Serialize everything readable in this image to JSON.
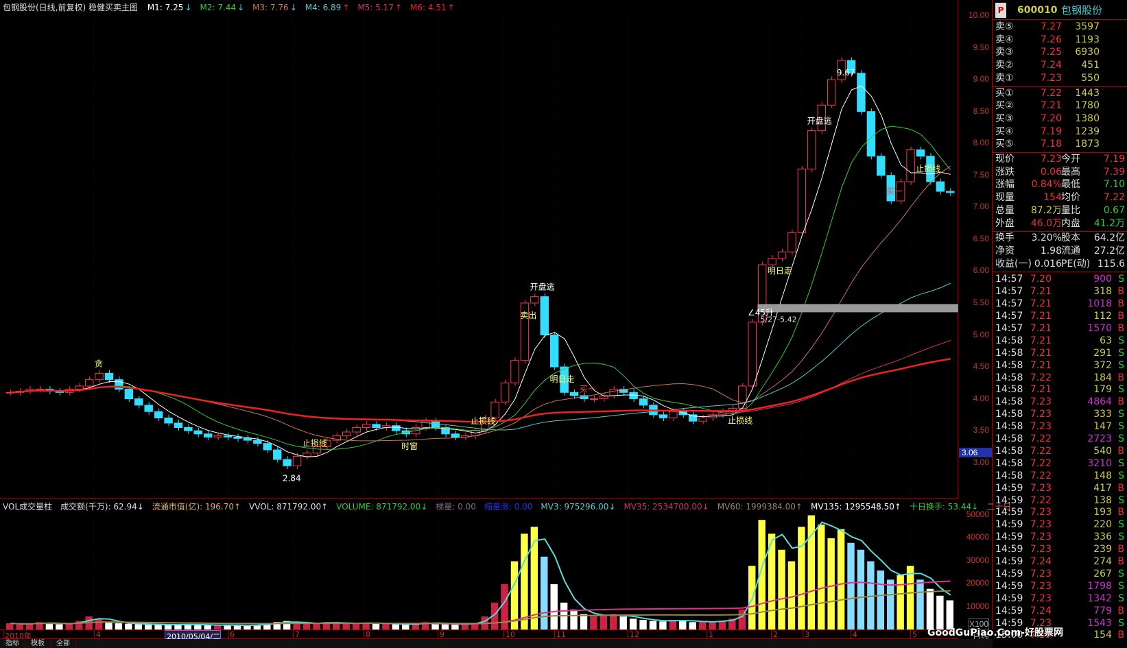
{
  "header": {
    "title": "包钢股份(日线,前复权) 稳健买卖主图",
    "mas": [
      {
        "label": "M1: 7.25",
        "arrow": "↓",
        "color": "#ffffff"
      },
      {
        "label": "M2: 7.44",
        "arrow": "↓",
        "color": "#33cc33"
      },
      {
        "label": "M3: 7.76",
        "arrow": "↓",
        "color": "#cc7755"
      },
      {
        "label": "M4: 6.89",
        "arrow": "↑",
        "color": "#55cccc"
      },
      {
        "label": "M5: 5.17",
        "arrow": "↑",
        "color": "#cc3366"
      },
      {
        "label": "M6: 4.51",
        "arrow": "↑",
        "color": "#ee2222"
      }
    ]
  },
  "indicator": {
    "items": [
      {
        "label": "VOL成交量柱",
        "color": "#dddddd"
      },
      {
        "label": "成交额(千万): 62.94↓",
        "color": "#dddddd"
      },
      {
        "label": "流通市值(亿): 196.70↑",
        "color": "#e0b070"
      },
      {
        "label": "VVOL: 871792.00↑",
        "color": "#dddddd"
      },
      {
        "label": "VOLUME: 871792.00↓",
        "color": "#33cc33"
      },
      {
        "label": "梯量: 0.00",
        "color": "#886688"
      },
      {
        "label": "缩量涨: 0.00",
        "color": "#2233ee"
      },
      {
        "label": "MV3: 975296.00↓",
        "color": "#55cccc"
      },
      {
        "label": "MV35: 2534700.00↓",
        "color": "#cc3377"
      },
      {
        "label": "MV60: 1999384.00↑",
        "color": "#998866"
      },
      {
        "label": "MV135: 1295548.50↑",
        "color": "#ffffff"
      },
      {
        "label": "十日换手: 53.44↓",
        "color": "#33cc33"
      },
      {
        "label": "二十日",
        "color": "#cc6633"
      }
    ],
    "axis": [
      "50000",
      "40000",
      "30000",
      "20000",
      "10000"
    ],
    "unit": "X100"
  },
  "price_axis": [
    "10.00",
    "9.50",
    "9.00",
    "8.50",
    "8.00",
    "7.50",
    "7.00",
    "6.50",
    "6.00",
    "5.50",
    "5.00",
    "4.50",
    "4.00",
    "3.50",
    "3.00"
  ],
  "cursor_price": "3.06",
  "xaxis": {
    "year": "2010年",
    "cursor_date": "2010/05/04/二",
    "months": [
      "4",
      "6",
      "7",
      "8",
      "9",
      "10",
      "11",
      "12",
      "1",
      "2",
      "3",
      "4",
      "5"
    ],
    "period": "日线"
  },
  "tabs": [
    "指标",
    "模板",
    "全部"
  ],
  "chart_data": {
    "type": "candlestick",
    "closes": [
      4.1,
      4.12,
      4.15,
      4.15,
      4.12,
      4.1,
      4.15,
      4.2,
      4.3,
      4.4,
      4.3,
      4.15,
      4.0,
      3.9,
      3.8,
      3.7,
      3.62,
      3.55,
      3.5,
      3.45,
      3.4,
      3.42,
      3.4,
      3.38,
      3.35,
      3.3,
      3.2,
      3.05,
      2.95,
      3.1,
      3.15,
      3.25,
      3.35,
      3.42,
      3.48,
      3.55,
      3.6,
      3.55,
      3.58,
      3.5,
      3.45,
      3.55,
      3.65,
      3.55,
      3.45,
      3.4,
      3.42,
      3.5,
      3.7,
      3.95,
      4.25,
      4.6,
      5.5,
      5.6,
      5.0,
      4.5,
      4.1,
      4.05,
      4.0,
      4.0,
      4.05,
      4.15,
      4.1,
      4.0,
      3.9,
      3.75,
      3.7,
      3.8,
      3.75,
      3.65,
      3.7,
      3.75,
      3.8,
      3.85,
      4.2,
      5.2,
      6.1,
      6.2,
      6.3,
      6.6,
      7.6,
      8.2,
      8.6,
      9.0,
      9.3,
      9.1,
      8.5,
      7.8,
      7.5,
      7.1,
      7.4,
      7.9,
      7.8,
      7.4,
      7.25,
      7.23
    ],
    "volumes": [
      3000,
      2500,
      2800,
      3500,
      3000,
      2600,
      2800,
      4000,
      6000,
      5000,
      3500,
      3000,
      2800,
      2600,
      2500,
      2400,
      2300,
      2500,
      2600,
      2200,
      2100,
      2300,
      2200,
      2000,
      2100,
      2400,
      3000,
      3500,
      4000,
      3000,
      2800,
      3200,
      3500,
      3000,
      2800,
      3100,
      3300,
      2800,
      2900,
      2600,
      2500,
      2800,
      3500,
      3000,
      2600,
      2500,
      2700,
      3200,
      6000,
      12000,
      20000,
      30000,
      42000,
      45000,
      32000,
      20000,
      12000,
      9000,
      7000,
      6000,
      6500,
      7000,
      6000,
      5000,
      4500,
      4000,
      3800,
      4500,
      4200,
      3500,
      3600,
      3800,
      4200,
      5000,
      9000,
      28000,
      48000,
      42000,
      35000,
      30000,
      45000,
      50000,
      46000,
      40000,
      44000,
      38000,
      35000,
      30000,
      26000,
      22000,
      24000,
      28000,
      22000,
      18000,
      15000,
      13000
    ],
    "ylim": [
      2.8,
      10.2
    ],
    "vol_ylim": [
      0,
      55000
    ],
    "annotations": [
      {
        "i": 9,
        "text": "贪",
        "color": "#ffff66"
      },
      {
        "i": 28,
        "text": "2.84",
        "color": "#ffffff"
      },
      {
        "i": 30,
        "text": "止损线",
        "color": "#ffff66"
      },
      {
        "i": 40,
        "text": "时窗",
        "color": "#ffff66"
      },
      {
        "i": 47,
        "text": "止损线",
        "color": "#ffff66"
      },
      {
        "i": 52,
        "text": "卖出",
        "color": "#ffff66"
      },
      {
        "i": 53,
        "text": "开盘逃",
        "color": "#ffffff"
      },
      {
        "i": 55,
        "text": "明日走",
        "color": "#ffff66"
      },
      {
        "i": 58,
        "text": "买一",
        "color": "#ff4444"
      },
      {
        "i": 73,
        "text": "止损线",
        "color": "#ffff66"
      },
      {
        "i": 75,
        "text": "∠45升",
        "color": "#ffffff"
      },
      {
        "i": 77,
        "text": "明日走",
        "color": "#ffff66"
      },
      {
        "i": 81,
        "text": "开盘逃",
        "color": "#ffffff"
      },
      {
        "i": 84,
        "text": "9.67",
        "color": "#ffffff"
      },
      {
        "i": 89,
        "text": "买一",
        "color": "#ff4444"
      },
      {
        "i": 92,
        "text": "止损线",
        "color": "#ffff66"
      }
    ],
    "band": {
      "label": "5/27-5.42",
      "price": 5.42,
      "start": 76
    }
  },
  "quote": {
    "badge": "P",
    "code": "600010",
    "name": "包钢股份",
    "asks": [
      {
        "l": "卖⑤",
        "p": "7.27",
        "v": "3597"
      },
      {
        "l": "卖④",
        "p": "7.26",
        "v": "1193"
      },
      {
        "l": "卖③",
        "p": "7.25",
        "v": "6930"
      },
      {
        "l": "卖②",
        "p": "7.24",
        "v": "451"
      },
      {
        "l": "卖①",
        "p": "7.23",
        "v": "550"
      }
    ],
    "bids": [
      {
        "l": "买①",
        "p": "7.22",
        "v": "1443"
      },
      {
        "l": "买②",
        "p": "7.21",
        "v": "1780"
      },
      {
        "l": "买③",
        "p": "7.20",
        "v": "1380"
      },
      {
        "l": "买④",
        "p": "7.19",
        "v": "1239"
      },
      {
        "l": "买⑤",
        "p": "7.18",
        "v": "1873"
      }
    ],
    "stats": [
      [
        "现价",
        "7.23",
        "red",
        "今开",
        "7.19",
        "red"
      ],
      [
        "涨跌",
        "0.06",
        "red",
        "最高",
        "7.39",
        "red"
      ],
      [
        "涨幅",
        "0.84%",
        "red",
        "最低",
        "7.10",
        "grn"
      ],
      [
        "现量",
        "154",
        "red",
        "均价",
        "7.22",
        "red"
      ],
      [
        "总量",
        "87.2万",
        "yel",
        "量比",
        "0.67",
        "grn"
      ],
      [
        "外盘",
        "46.0万",
        "red",
        "内盘",
        "41.2万",
        "grn"
      ]
    ],
    "fin": [
      [
        "换手",
        "3.20%",
        "股本",
        "64.2亿"
      ],
      [
        "净资",
        "1.98",
        "流通",
        "27.2亿"
      ],
      [
        "收益(一)",
        "0.016",
        "PE(动)",
        "115.6"
      ]
    ],
    "ticks": [
      [
        "14:57",
        "7.20",
        "900",
        "S"
      ],
      [
        "14:57",
        "7.21",
        "318",
        "B"
      ],
      [
        "14:57",
        "7.21",
        "1018",
        "B"
      ],
      [
        "14:57",
        "7.21",
        "112",
        "B"
      ],
      [
        "14:57",
        "7.21",
        "1570",
        "B"
      ],
      [
        "14:58",
        "7.21",
        "63",
        "S"
      ],
      [
        "14:58",
        "7.21",
        "291",
        "S"
      ],
      [
        "14:58",
        "7.21",
        "372",
        "S"
      ],
      [
        "14:58",
        "7.22",
        "184",
        "B"
      ],
      [
        "14:58",
        "7.21",
        "179",
        "S"
      ],
      [
        "14:58",
        "7.23",
        "4864",
        "B"
      ],
      [
        "14:58",
        "7.23",
        "333",
        "S"
      ],
      [
        "14:58",
        "7.23",
        "147",
        "S"
      ],
      [
        "14:58",
        "7.22",
        "2723",
        "S"
      ],
      [
        "14:58",
        "7.22",
        "540",
        "B"
      ],
      [
        "14:58",
        "7.22",
        "3210",
        "S"
      ],
      [
        "14:58",
        "7.22",
        "148",
        "S"
      ],
      [
        "14:59",
        "7.23",
        "417",
        "B"
      ],
      [
        "14:59",
        "7.22",
        "138",
        "S"
      ],
      [
        "14:59",
        "7.23",
        "193",
        "B"
      ],
      [
        "14:59",
        "7.23",
        "220",
        "S"
      ],
      [
        "14:59",
        "7.23",
        "336",
        "S"
      ],
      [
        "14:59",
        "7.23",
        "239",
        "B"
      ],
      [
        "14:59",
        "7.24",
        "274",
        "B"
      ],
      [
        "14:59",
        "7.23",
        "267",
        "S"
      ],
      [
        "14:59",
        "7.23",
        "1798",
        "S"
      ],
      [
        "14:59",
        "7.23",
        "1342",
        "S"
      ],
      [
        "14:59",
        "7.24",
        "779",
        "B"
      ],
      [
        "14:59",
        "7.23",
        "1543",
        "S"
      ],
      [
        "15:00",
        "7.23",
        "154",
        "B"
      ]
    ]
  },
  "watermark": "GoodGuPiao.Com-好股票网"
}
